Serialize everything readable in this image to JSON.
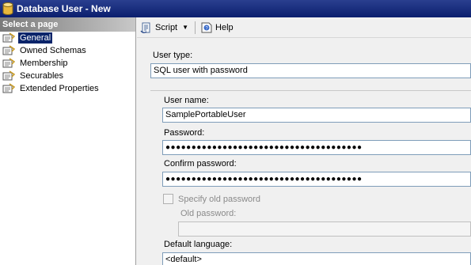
{
  "window": {
    "title": "Database User - New"
  },
  "sidebar": {
    "header": "Select a page",
    "items": [
      {
        "label": "General",
        "selected": true
      },
      {
        "label": "Owned Schemas",
        "selected": false
      },
      {
        "label": "Membership",
        "selected": false
      },
      {
        "label": "Securables",
        "selected": false
      },
      {
        "label": "Extended Properties",
        "selected": false
      }
    ]
  },
  "toolbar": {
    "script_label": "Script",
    "help_label": "Help"
  },
  "form": {
    "user_type_label": "User type:",
    "user_type_value": "SQL user with password",
    "user_name_label": "User name:",
    "user_name_value": "SamplePortableUser",
    "password_label": "Password:",
    "password_value": "●●●●●●●●●●●●●●●●●●●●●●●●●●●●●●●●●●●●●●",
    "confirm_password_label": "Confirm password:",
    "confirm_password_value": "●●●●●●●●●●●●●●●●●●●●●●●●●●●●●●●●●●●●●●",
    "specify_old_password_label": "Specify old password",
    "specify_old_password_checked": false,
    "old_password_label": "Old password:",
    "old_password_value": "",
    "default_language_label": "Default language:",
    "default_language_value": "<default>"
  },
  "colors": {
    "title_bar": "#0b1f6e",
    "selection": "#0a246a"
  }
}
